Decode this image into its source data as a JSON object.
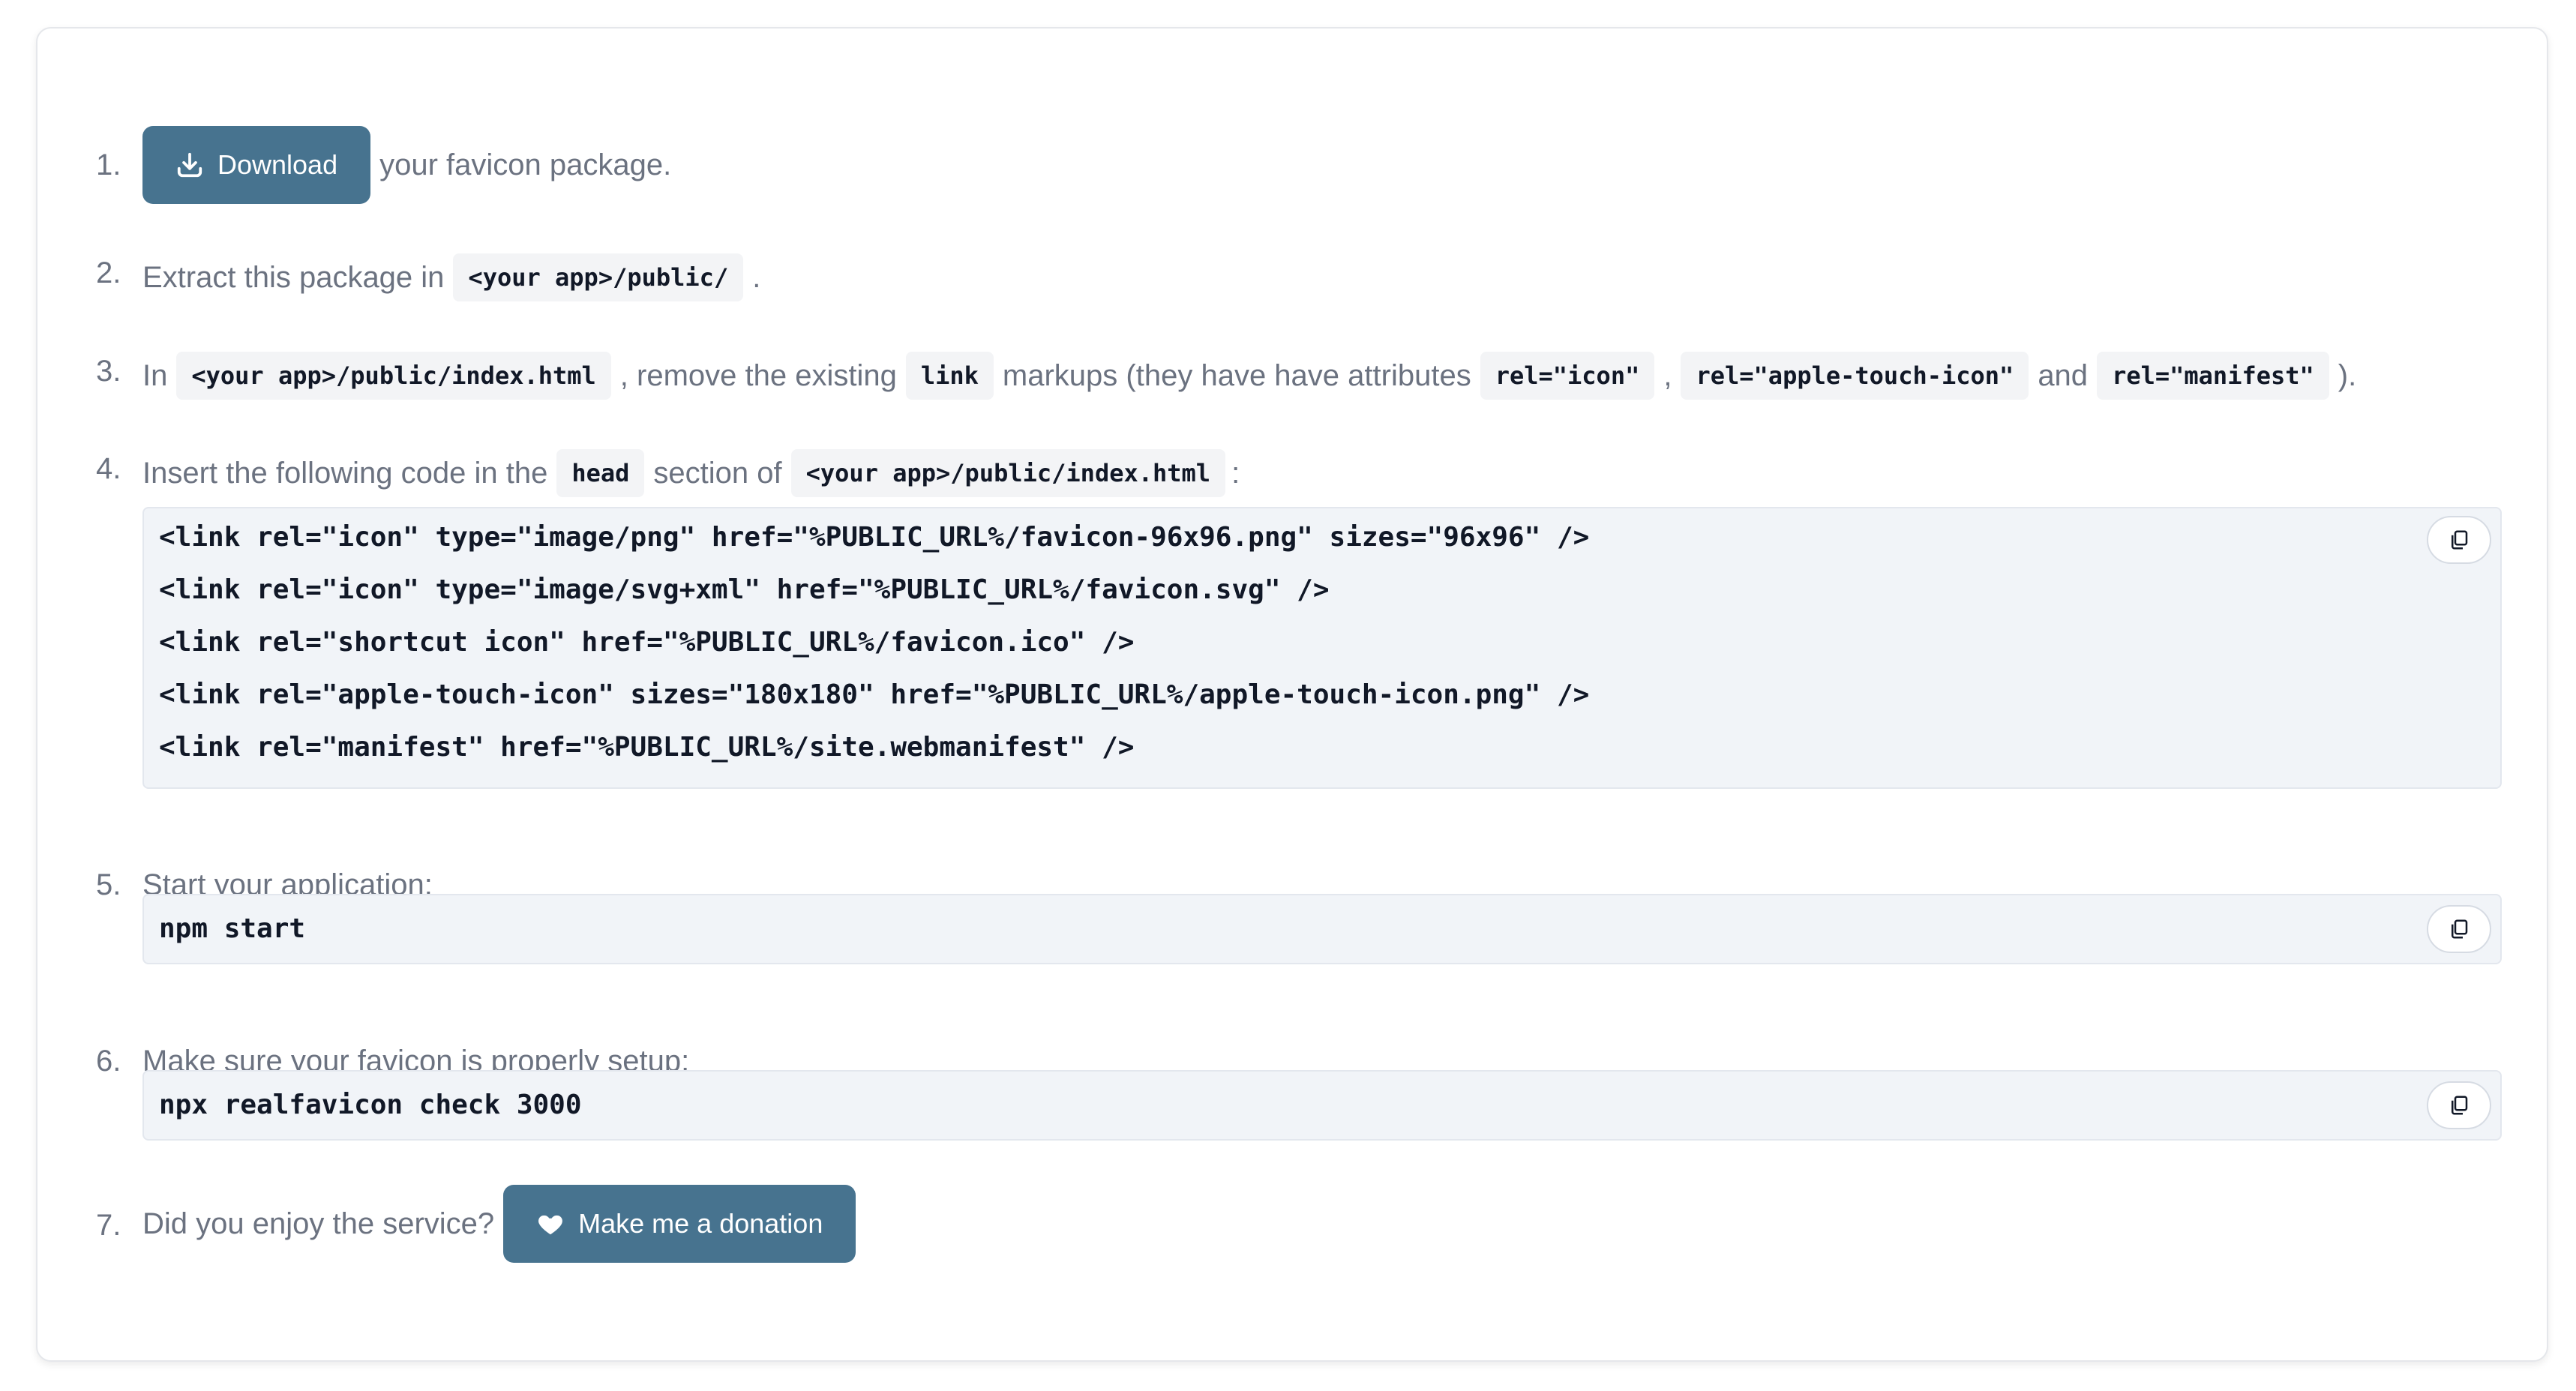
{
  "steps": [
    {
      "num": "1.",
      "button": "Download",
      "after": "your favicon package."
    },
    {
      "num": "2.",
      "before": "Extract this package in",
      "code": "<your app>/public/",
      "after": "."
    },
    {
      "num": "3.",
      "parts": [
        "In",
        "<your app>/public/index.html",
        ", remove the existing",
        "link",
        "markups (they have have attributes",
        "rel=\"icon\"",
        ",",
        "rel=\"apple-touch-icon\"",
        "and",
        "rel=\"manifest\"",
        ")."
      ]
    },
    {
      "num": "4.",
      "parts": [
        "Insert the following code in the",
        "head",
        "section of",
        "<your app>/public/index.html",
        ":"
      ],
      "code_lines": [
        "<link rel=\"icon\" type=\"image/png\" href=\"%PUBLIC_URL%/favicon-96x96.png\" sizes=\"96x96\" />",
        "<link rel=\"icon\" type=\"image/svg+xml\" href=\"%PUBLIC_URL%/favicon.svg\" />",
        "<link rel=\"shortcut icon\" href=\"%PUBLIC_URL%/favicon.ico\" />",
        "<link rel=\"apple-touch-icon\" sizes=\"180x180\" href=\"%PUBLIC_URL%/apple-touch-icon.png\" />",
        "<link rel=\"manifest\" href=\"%PUBLIC_URL%/site.webmanifest\" />"
      ]
    },
    {
      "num": "5.",
      "text": "Start your application:",
      "code_lines": [
        "npm start"
      ]
    },
    {
      "num": "6.",
      "text": "Make sure your favicon is properly setup:",
      "code_lines": [
        "npx realfavicon check 3000"
      ]
    },
    {
      "num": "7.",
      "text": "Did you enjoy the service?",
      "button": "Make me a donation"
    }
  ],
  "icons": {
    "download": "download-icon",
    "copy": "copy-icon",
    "heart": "heart-icon"
  },
  "colors": {
    "button_bg": "#47738f",
    "code_bg": "#f1f4f8",
    "text": "#6b7280",
    "code_text": "#111827"
  }
}
